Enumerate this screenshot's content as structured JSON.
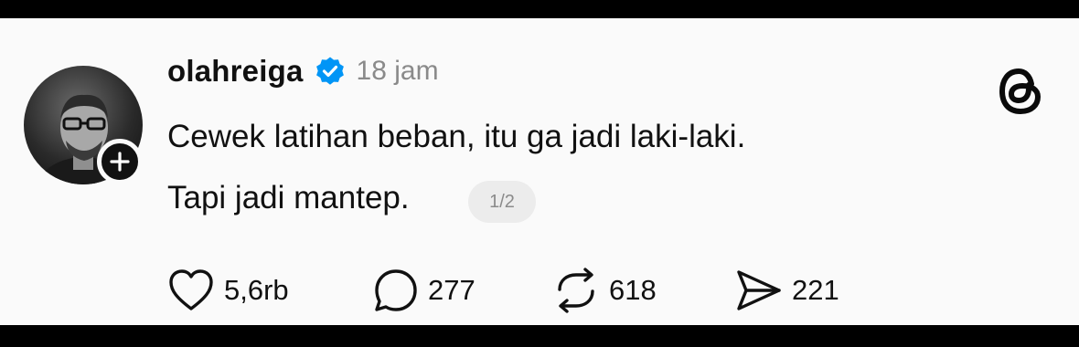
{
  "post": {
    "username": "olahreiga",
    "time": "18 jam",
    "line1": "Cewek latihan beban, itu ga jadi laki-laki.",
    "line2": "Tapi jadi mantep.",
    "pager": "1/2"
  },
  "actions": {
    "likes": "5,6rb",
    "replies": "277",
    "reposts": "618",
    "shares": "221"
  },
  "icons": {
    "verified": "verified-badge-icon",
    "follow": "plus-icon",
    "brand": "threads-logo-icon",
    "like": "heart-icon",
    "reply": "comment-bubble-icon",
    "repost": "repost-icon",
    "share": "send-icon"
  },
  "colors": {
    "background": "#fafafa",
    "text": "#111111",
    "muted": "#8a8a8a",
    "verified_blue": "#0095f6"
  }
}
